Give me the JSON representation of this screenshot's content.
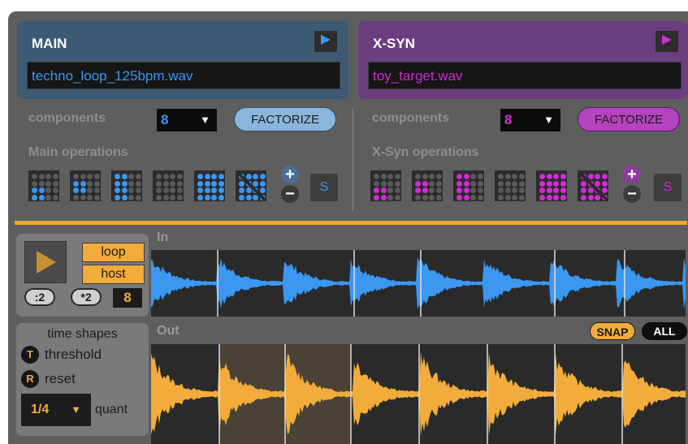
{
  "colors": {
    "main_accent": "#3b97f0",
    "xsyn_accent": "#d12bd6",
    "orange": "#f2ac3c",
    "device_bg": "#5e5e5e"
  },
  "main": {
    "title": "MAIN",
    "file": "techno_loop_125bpm.wav",
    "components_label": "components",
    "components_value": "8",
    "factorize_label": "FACTORIZE",
    "operations_label": "Main operations",
    "s_label": "S"
  },
  "xsyn": {
    "title": "X-SYN",
    "file": "toy_target.wav",
    "components_label": "components",
    "components_value": "8",
    "factorize_label": "FACTORIZE",
    "operations_label": "X-Syn operations",
    "s_label": "S"
  },
  "transport": {
    "loop_label": "loop",
    "host_label": "host",
    "half_label": ":2",
    "double_label": "*2",
    "count_value": "8"
  },
  "lanes": {
    "in_label": "In",
    "out_label": "Out"
  },
  "time_shapes": {
    "title": "time shapes",
    "threshold_key": "T",
    "threshold_label": "threshold",
    "reset_key": "R",
    "reset_label": "reset",
    "quant_value": "1/4",
    "quant_label": "quant"
  },
  "out_buttons": {
    "snap_label": "SNAP",
    "all_label": "ALL"
  }
}
